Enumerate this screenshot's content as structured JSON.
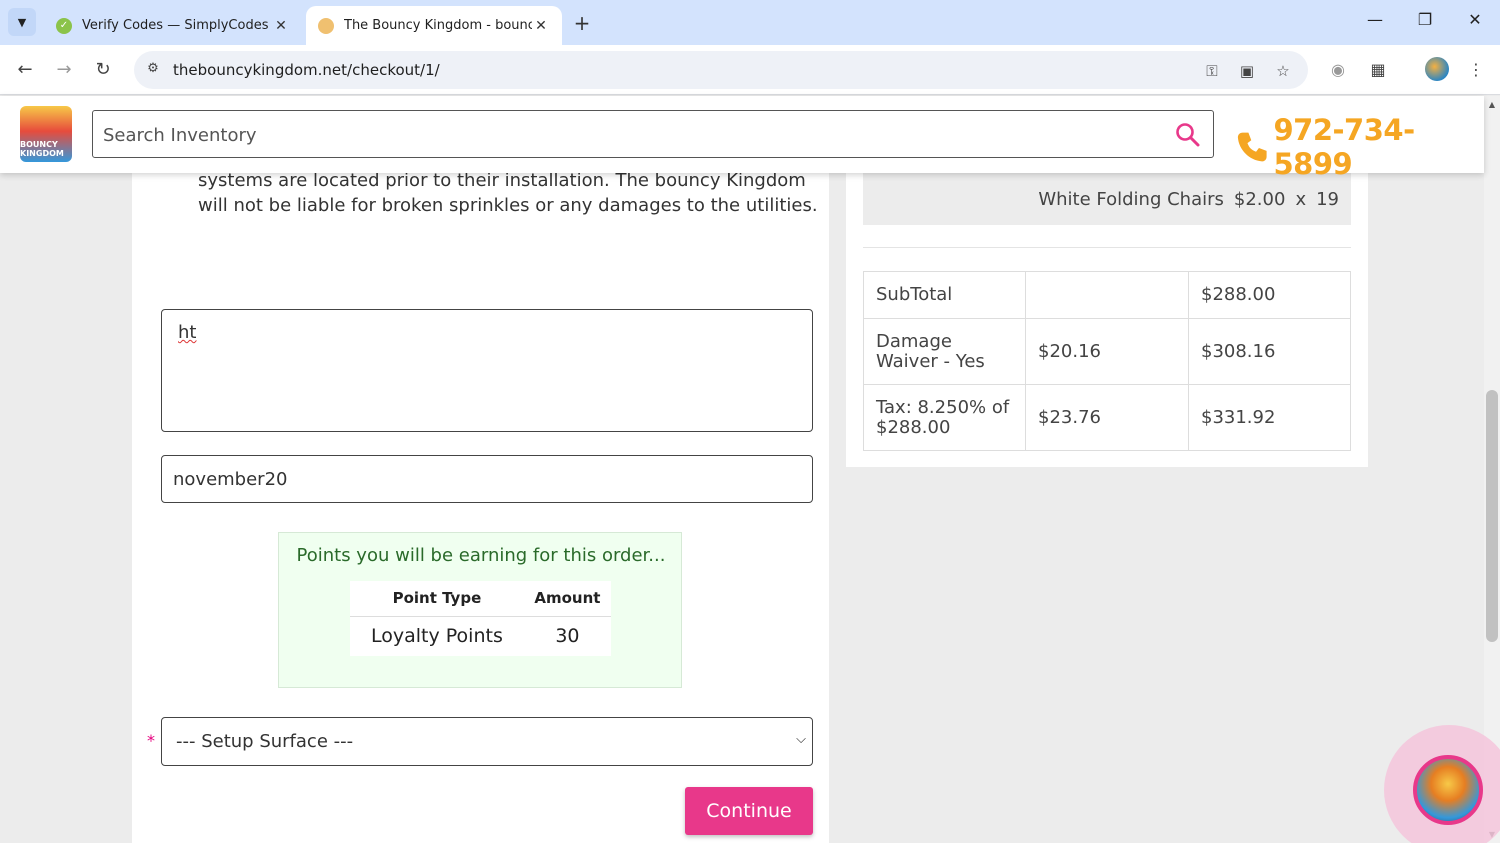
{
  "browser": {
    "tabs": [
      {
        "title": "Verify Codes — SimplyCodes",
        "active": false
      },
      {
        "title": "The Bouncy Kingdom - bounce",
        "active": true
      }
    ],
    "url": "thebouncykingdom.net/checkout/1/"
  },
  "header": {
    "logo_text": "BOUNCY KINGDOM",
    "search_placeholder": "Search Inventory",
    "phone": "972-734-5899"
  },
  "form": {
    "terms_text": "systems are located prior to their installation. The bouncy Kingdom will not be liable for broken sprinkles or any damages to the utilities.",
    "notes_value": "ht",
    "coupon_value": "november20",
    "points": {
      "title": "Points you will be earning for this order...",
      "columns": [
        "Point Type",
        "Amount"
      ],
      "rows": [
        {
          "type": "Loyalty Points",
          "amount": "30"
        }
      ]
    },
    "required_mark": "*",
    "setup_surface": "--- Setup Surface ---",
    "continue_label": "Continue"
  },
  "summary": {
    "item": {
      "name": "White Folding Chairs",
      "price": "$2.00",
      "x": "x",
      "qty": "19"
    },
    "rows": [
      {
        "label": "SubTotal",
        "amount": "",
        "total": "$288.00"
      },
      {
        "label": "Damage Waiver - Yes",
        "amount": "$20.16",
        "total": "$308.16"
      },
      {
        "label": "Tax: 8.250% of $288.00",
        "amount": "$23.76",
        "total": "$331.92"
      }
    ]
  },
  "colors": {
    "accent_pink": "#e8388a",
    "phone_orange": "#f5a623",
    "points_bg": "#f0fff0",
    "tab_strip": "#d3e3fd"
  }
}
